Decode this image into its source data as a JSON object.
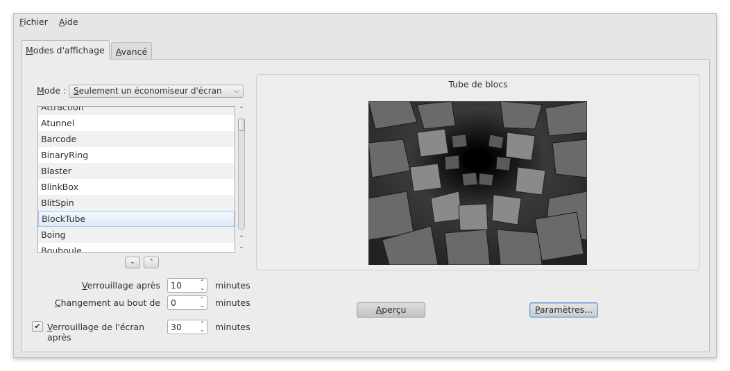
{
  "menubar": {
    "file": {
      "accel": "F",
      "rest": "ichier"
    },
    "help": {
      "accel": "A",
      "rest": "ide"
    }
  },
  "tabs": [
    {
      "accel": "M",
      "rest": "odes d'affichage"
    },
    {
      "accel": "A",
      "rest": "vancé"
    }
  ],
  "mode": {
    "label_accel": "M",
    "label_rest": "ode :",
    "value_accel": "S",
    "value_rest": "eulement un économiseur d'écran"
  },
  "screensaver_list": {
    "items": [
      "Attraction",
      "Atunnel",
      "Barcode",
      "BinaryRing",
      "Blaster",
      "BlinkBox",
      "BlitSpin",
      "BlockTube",
      "Boing",
      "Bouboule"
    ],
    "selected": "BlockTube"
  },
  "lock_after": {
    "label_accel": "V",
    "label_rest": "errouillage après",
    "value": "10",
    "unit": "minutes"
  },
  "change_after": {
    "label_accel": "C",
    "label_rest": "hangement au bout de",
    "value": "0",
    "unit": "minutes"
  },
  "screen_lock": {
    "checked": true,
    "label_accel": "V",
    "label_rest": "errouillage de l'écran après",
    "value": "30",
    "unit": "minutes"
  },
  "preview": {
    "title": "Tube de blocs"
  },
  "buttons": {
    "preview": {
      "accel": "A",
      "rest": "perçu"
    },
    "settings": {
      "accel": "P",
      "rest": "aramètres..."
    }
  }
}
